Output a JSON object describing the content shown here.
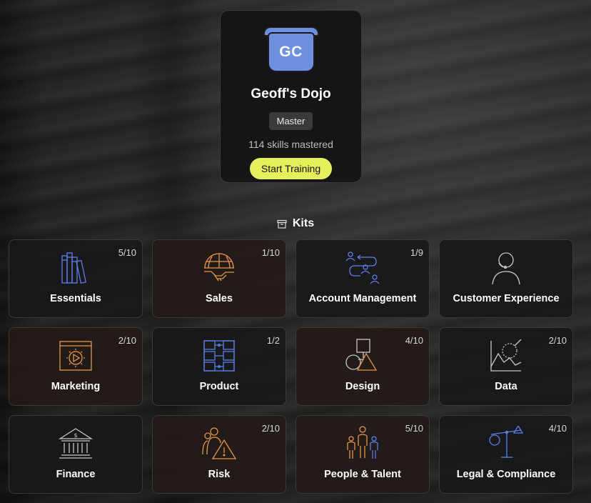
{
  "profile": {
    "avatar_initials": "GC",
    "avatar_color": "#6f8fe0",
    "title": "Geoff's Dojo",
    "rank": "Master",
    "skills": "114 skills mastered",
    "cta": "Start Training",
    "cta_color": "#e5f05c"
  },
  "kits": {
    "heading": "Kits",
    "heading_icon": "archive-box-icon",
    "items": [
      {
        "label": "Essentials",
        "progress": "5/10",
        "icon": "books-icon",
        "color": "#5b7fe6"
      },
      {
        "label": "Sales",
        "progress": "1/10",
        "icon": "globe-handshake-icon",
        "color": "#e8954a"
      },
      {
        "label": "Account Management",
        "progress": "1/9",
        "icon": "people-exchange-icon",
        "color": "#5b7fe6"
      },
      {
        "label": "Customer Experience",
        "progress": "",
        "icon": "person-headset-icon",
        "color": "#c8c8c8"
      },
      {
        "label": "Marketing",
        "progress": "2/10",
        "icon": "video-play-icon",
        "color": "#e8954a"
      },
      {
        "label": "Product",
        "progress": "1/2",
        "icon": "product-blocks-icon",
        "color": "#5b7fe6"
      },
      {
        "label": "Design",
        "progress": "4/10",
        "icon": "shapes-icon",
        "color": "#e8954a"
      },
      {
        "label": "Data",
        "progress": "2/10",
        "icon": "chart-magnifier-icon",
        "color": "#c8c8c8"
      },
      {
        "label": "Finance",
        "progress": "",
        "icon": "bank-icon",
        "color": "#c8c8c8"
      },
      {
        "label": "Risk",
        "progress": "2/10",
        "icon": "people-warning-icon",
        "color": "#e8954a"
      },
      {
        "label": "People & Talent",
        "progress": "5/10",
        "icon": "team-icon",
        "color": "#e8954a"
      },
      {
        "label": "Legal & Compliance",
        "progress": "4/10",
        "icon": "scales-icon",
        "color": "#5b7fe6"
      }
    ]
  }
}
